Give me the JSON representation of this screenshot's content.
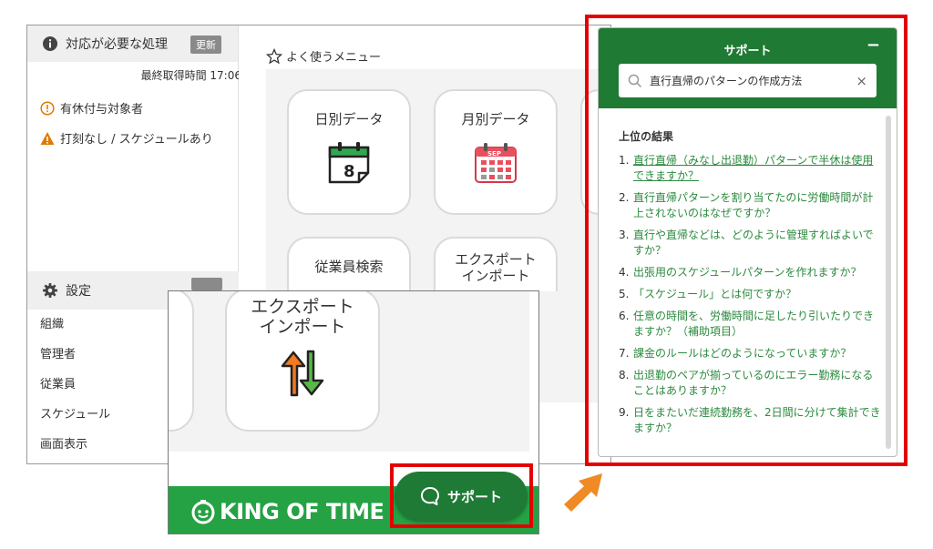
{
  "left_panel": {
    "todo_title": "対応が必要な処理",
    "update_button": "更新",
    "last_fetch": "最終取得時間 17:06",
    "alerts": [
      {
        "label": "有休付与対象者",
        "color": "#e07a00"
      },
      {
        "label": "打刻なし / スケジュールあり",
        "color": "#e07a00"
      }
    ],
    "settings_title": "設定",
    "settings_items": [
      "組織",
      "管理者",
      "従業員",
      "スケジュール",
      "画面表示"
    ]
  },
  "menu": {
    "title": "よく使うメニュー",
    "tiles": [
      {
        "label": "日別データ",
        "icon": "calendar-day-icon",
        "day": "8"
      },
      {
        "label": "月別データ",
        "icon": "calendar-month-icon",
        "month": "SEP"
      },
      {
        "label": "",
        "icon": ""
      },
      {
        "label": "従業員検索",
        "icon": "search-user-icon"
      },
      {
        "label": "エクスポート\nインポート",
        "icon": "export-import-icon"
      }
    ]
  },
  "inset": {
    "tile_label": "エクスポート\nインポート",
    "brand": "KING OF TIME",
    "support_button": "サポート"
  },
  "support_panel": {
    "title": "サポート",
    "minimize": "−",
    "search_value": "直行直帰のパターンの作成方法",
    "search_clear": "×",
    "results_title": "上位の結果",
    "results": [
      {
        "num": "1.",
        "text": "直行直帰（みなし出退勤）パターンで半休は使用できますか？"
      },
      {
        "num": "2.",
        "text": "直行直帰パターンを割り当てたのに労働時間が計上されないのはなぜですか？"
      },
      {
        "num": "3.",
        "text": "直行や直帰などは、どのように管理すればよいですか？"
      },
      {
        "num": "4.",
        "text": "出張用のスケジュールパターンを作れますか？"
      },
      {
        "num": "5.",
        "text": "「スケジュール」とは何ですか？"
      },
      {
        "num": "6.",
        "text": "任意の時間を、労働時間に足したり引いたりできますか？（補助項目）"
      },
      {
        "num": "7.",
        "text": "課金のルールはどのようになっていますか？"
      },
      {
        "num": "8.",
        "text": "出退勤のペアが揃っているのにエラー勤務になることはありますか？"
      },
      {
        "num": "9.",
        "text": "日をまたいだ連続勤務を、2日間に分けて集計できますか？"
      }
    ]
  },
  "colors": {
    "brand_green": "#25a244",
    "dark_green": "#1f7a34",
    "link_green": "#2b8a3e",
    "highlight_red": "#e40000",
    "arrow_orange": "#f08a24"
  }
}
